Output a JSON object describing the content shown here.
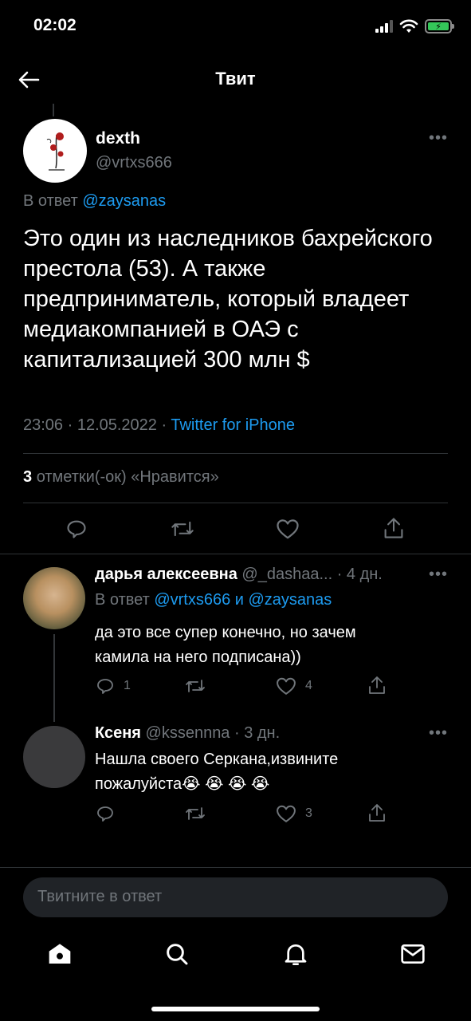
{
  "status_bar": {
    "time": "02:02"
  },
  "header": {
    "title": "Твит"
  },
  "main_tweet": {
    "name": "dexth",
    "handle": "@vrtxs666",
    "reply_prefix": "В ответ",
    "reply_to": "@zaysanas",
    "text": "Это один из наследников бахрейского престола (53). А также предприниматель, который владеет медиакомпанией в ОАЭ с капитализацией 300 млн $",
    "time_date": "23:06 · 12.05.2022 ·",
    "source": "Twitter for iPhone",
    "likes_count": "3",
    "likes_label": "отметки(-ок) «Нравится»"
  },
  "replies": [
    {
      "name": "дарья алексеевна",
      "handle_time": "@_dashaa... · 4 дн.",
      "reply_prefix": "В ответ",
      "reply_to": "@vrtxs666 и @zaysanas",
      "text_line1": "да это все супер конечно, но зачем",
      "text_line2": "камила на него подписана))",
      "reply_count": "1",
      "retweet_count": "",
      "like_count": "4"
    },
    {
      "name": "Ксеня",
      "handle_time": "@kssennna · 3 дн.",
      "text_line1": "Нашла своего Серкана,извините",
      "text_line2": "пожалуйста",
      "emoji": "😭 😭 😭 😭",
      "reply_count": "",
      "retweet_count": "",
      "like_count": "3"
    }
  ],
  "compose": {
    "placeholder": "Твитните в ответ"
  },
  "icons": {
    "back": "back-arrow-icon",
    "reply": "reply-icon",
    "retweet": "retweet-icon",
    "like": "heart-icon",
    "share": "share-icon",
    "home": "home-icon",
    "search": "search-icon",
    "notifications": "bell-icon",
    "messages": "mail-icon"
  },
  "colors": {
    "accent": "#1d9bf0",
    "muted": "#71767b",
    "background": "#000000"
  }
}
